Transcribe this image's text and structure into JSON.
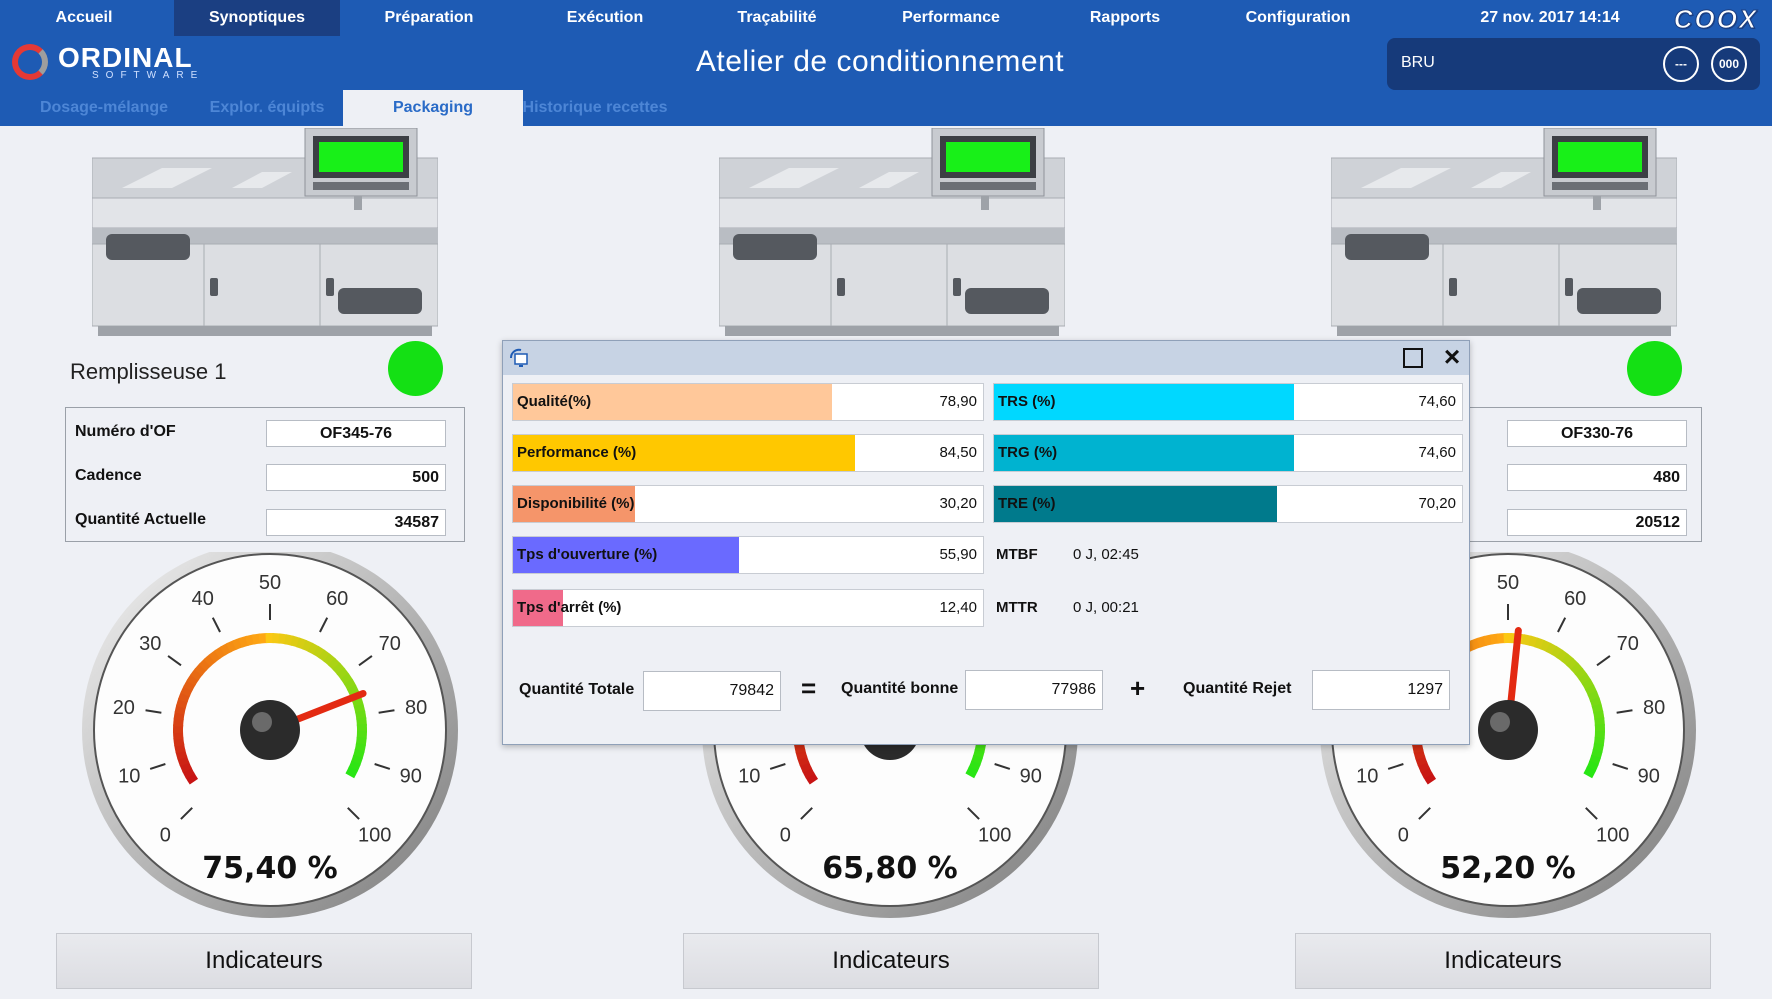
{
  "nav": {
    "items": [
      "Accueil",
      "Synoptiques",
      "Préparation",
      "Exécution",
      "Traçabilité",
      "Performance",
      "Rapports",
      "Configuration"
    ],
    "active_index": 1,
    "datetime": "27 nov. 2017 14:14",
    "brand_logo": "COOX"
  },
  "logo": {
    "name": "ORDINAL",
    "sub": "SOFTWARE"
  },
  "page_title": "Atelier de conditionnement",
  "user": {
    "name": "BRU",
    "btn_menu": "---",
    "btn_code": "000"
  },
  "sub_tabs": {
    "items": [
      "Dosage-mélange",
      "Explor. équipts",
      "Packaging",
      "Historique recettes"
    ],
    "active_index": 2
  },
  "machines": [
    {
      "name": "Remplisseuse 1",
      "status_color": "#14e014",
      "labels": [
        "Numéro d'OF",
        "Cadence",
        "Quantité Actuelle"
      ],
      "of_number": "OF345-76",
      "cadence": "500",
      "quantity": "34587",
      "gauge_value": 75.4,
      "gauge_text": "75,40 %",
      "button": "Indicateurs"
    },
    {
      "gauge_value": 65.8,
      "gauge_text": "65,80 %",
      "button": "Indicateurs"
    },
    {
      "status_color": "#14e014",
      "of_number": "OF330-76",
      "cadence": "480",
      "quantity": "20512",
      "gauge_value": 52.2,
      "gauge_text": "52,20 %",
      "button": "Indicateurs"
    }
  ],
  "gauge_ticks": [
    "0",
    "10",
    "20",
    "30",
    "40",
    "50",
    "60",
    "70",
    "80",
    "90",
    "100"
  ],
  "popup": {
    "left_kpis": [
      {
        "label": "Qualité(%)",
        "value": "78,90",
        "fraction": 0.789,
        "color": "#ffc89a"
      },
      {
        "label": "Performance (%)",
        "value": "84,50",
        "fraction": 0.845,
        "color": "#ffc800"
      },
      {
        "label": "Disponibilité (%)",
        "value": "30,20",
        "fraction": 0.302,
        "color": "#f5956a"
      },
      {
        "label": "Tps d'ouverture (%)",
        "value": "55,90",
        "fraction": 0.559,
        "color": "#6a6aff"
      },
      {
        "label": "Tps d'arrêt (%)",
        "value": "12,40",
        "fraction": 0.124,
        "color": "#f06a8a"
      }
    ],
    "right_kpis": [
      {
        "label": "TRS (%)",
        "value": "74,60",
        "fraction": 0.746,
        "color": "#00d8ff"
      },
      {
        "label": "TRG (%)",
        "value": "74,60",
        "fraction": 0.746,
        "color": "#00b3d0"
      },
      {
        "label": "TRE (%)",
        "value": "70,20",
        "fraction": 0.702,
        "color": "#007a8c"
      }
    ],
    "mtbf_label": "MTBF",
    "mtbf_value": "0 J, 02:45",
    "mttr_label": "MTTR",
    "mttr_value": "0 J, 00:21",
    "qty_total_label": "Quantité Totale",
    "qty_total": "79842",
    "qty_good_label": "Quantité bonne",
    "qty_good": "77986",
    "qty_reject_label": "Quantité Rejet",
    "qty_reject": "1297",
    "op_equals": "=",
    "op_plus": "+"
  }
}
